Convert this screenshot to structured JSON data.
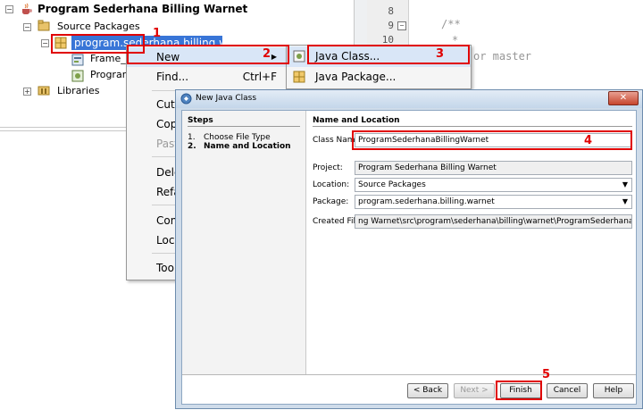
{
  "tree": {
    "project": "Program Sederhana Billing Warnet",
    "source_packages": "Source Packages",
    "package": "program.sederhana.billing.warnet",
    "file1": "Frame_",
    "file2": "Program",
    "libraries": "Libraries"
  },
  "editor": {
    "lines": [
      "8",
      "9",
      "10"
    ],
    "code_comment": "/**",
    "code_star": "*",
    "code_tail": "or master"
  },
  "context_menu": {
    "new": "New",
    "find": "Find...",
    "find_shortcut": "Ctrl+F",
    "cut": "Cut",
    "copy": "Cop",
    "paste": "Past",
    "delete": "Dele",
    "refactor": "Refa",
    "compile": "Con",
    "local": "Loc",
    "tools": "Too"
  },
  "submenu": {
    "java_class": "Java Class...",
    "java_package": "Java Package..."
  },
  "dialog": {
    "title": "New Java Class",
    "steps_heading": "Steps",
    "step1_num": "1.",
    "step1": "Choose File Type",
    "step2_num": "2.",
    "step2": "Name and Location",
    "section_heading": "Name and Location",
    "class_name_label": "Class Name:",
    "class_name_value": "ProgramSederhanaBillingWarnet",
    "project_label": "Project:",
    "project_value": "Program Sederhana Billing Warnet",
    "location_label": "Location:",
    "location_value": "Source Packages",
    "package_label": "Package:",
    "package_value": "program.sederhana.billing.warnet",
    "created_label": "Created File:",
    "created_value": "ng Warnet\\src\\program\\sederhana\\billing\\warnet\\ProgramSederhanaBillingWarneto.java",
    "back": "< Back",
    "next": "Next >",
    "finish": "Finish",
    "cancel": "Cancel",
    "help": "Help"
  },
  "callouts": [
    "1",
    "2",
    "3",
    "4",
    "5"
  ],
  "colors": {
    "callout": "#e00000",
    "selection": "#3875d7",
    "dialog_frame": "#cfdcea"
  }
}
